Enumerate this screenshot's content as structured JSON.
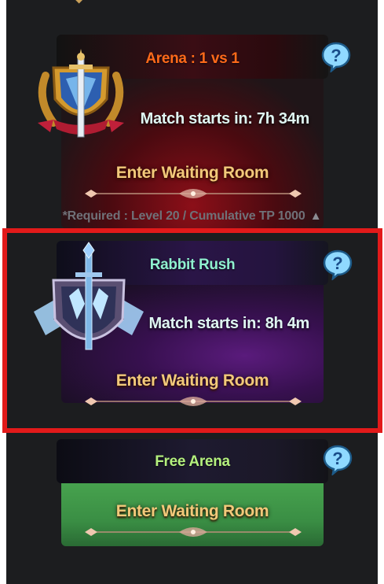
{
  "arena": {
    "title": "Arena : 1 vs 1",
    "match_text": "Match starts in: 7h 34m",
    "button_label": "Enter Waiting Room",
    "requirement": "*Required : Level 20 / Cumulative TP 1000",
    "requirement_icon": "triangle-up-icon"
  },
  "rabbit": {
    "title": "Rabbit Rush",
    "match_text": "Match starts in: 8h 4m",
    "button_label": "Enter Waiting Room"
  },
  "free": {
    "title": "Free Arena",
    "button_label": "Enter Waiting Room"
  },
  "icons": {
    "help": "help-speech-bubble-icon",
    "arena_emblem": "golden-shield-sword-emblem",
    "rabbit_emblem": "ice-shield-sword-emblem"
  },
  "colors": {
    "arena_title": "#ff6a1a",
    "rabbit_title": "#8ff0cf",
    "free_title": "#b4f07e",
    "button_text": "#f2c97a",
    "highlight_border": "#e21a1a"
  }
}
